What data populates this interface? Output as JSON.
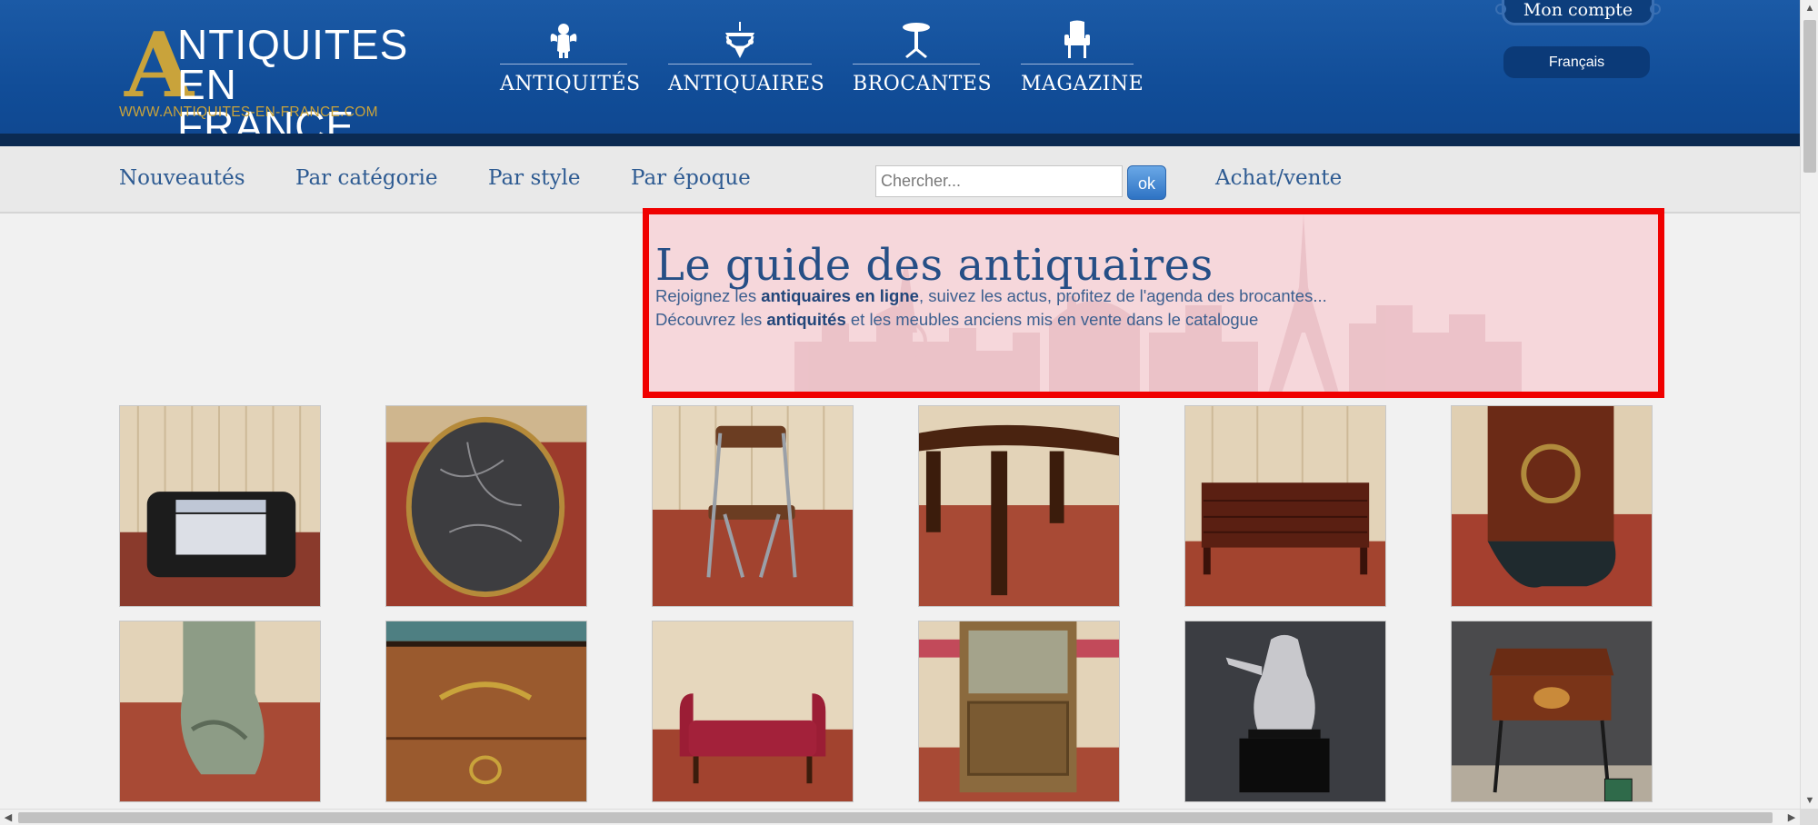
{
  "logo": {
    "letter": "A",
    "line1": "NTIQUITES",
    "line2": "EN FRANCE",
    "url": "WWW.ANTIQUITES-EN-FRANCE.COM"
  },
  "main_nav": [
    {
      "label": "ANTIQUITÉS",
      "icon": "cherub-icon"
    },
    {
      "label": "ANTIQUAIRES",
      "icon": "chandelier-icon"
    },
    {
      "label": "BROCANTES",
      "icon": "pedestal-table-icon"
    },
    {
      "label": "MAGAZINE",
      "icon": "armchair-icon"
    }
  ],
  "account": {
    "label": "Mon compte",
    "language": "Français"
  },
  "sub_nav": {
    "links": [
      "Nouveautés",
      "Par catégorie",
      "Par style",
      "Par époque"
    ],
    "search_placeholder": "Chercher...",
    "search_button": "ok",
    "trade_link": "Achat/vente"
  },
  "hero": {
    "title": "Le guide des antiquaires",
    "line1_a": "Rejoignez les ",
    "line1_b": "antiquaires en ligne",
    "line1_c": ", suivez les actus, profitez de l'agenda des brocantes...",
    "line2_a": "Découvrez les ",
    "line2_b": "antiquités",
    "line2_c": " et les meubles anciens mis en vente dans le catalogue"
  },
  "products": [
    {
      "subject": "black leather dog bed"
    },
    {
      "subject": "oval marble coffee table"
    },
    {
      "subject": "folding chair with brown seat"
    },
    {
      "subject": "round mahogany table"
    },
    {
      "subject": "mahogany chest of drawers"
    },
    {
      "subject": "bronze-mounted clock case foot"
    },
    {
      "subject": "painted carved console leg"
    },
    {
      "subject": "marble-top commode with bronze mount"
    },
    {
      "subject": "red velvet window seat"
    },
    {
      "subject": "oak display cabinet"
    },
    {
      "subject": "silver sculpture on black base"
    },
    {
      "subject": "marquetry side table"
    }
  ],
  "colors": {
    "header_blue": "#114d98",
    "header_dark": "#0b2a52",
    "gold": "#c9a33b",
    "link_blue": "#2e5b92",
    "highlight_red": "#f00000",
    "highlight_fill": "#f7ced3"
  }
}
